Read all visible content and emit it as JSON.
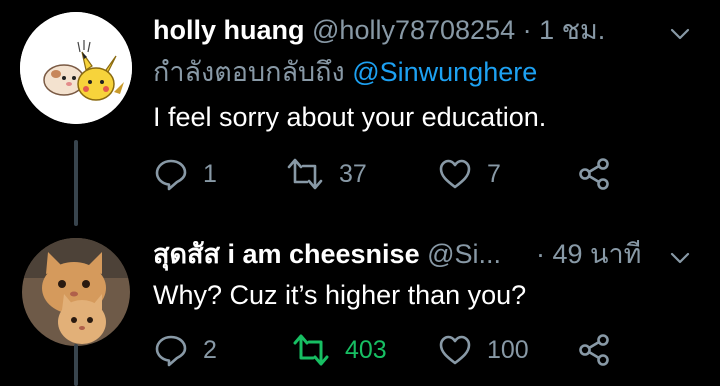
{
  "tweets": [
    {
      "display_name": "holly huang",
      "handle": "@holly78708254",
      "time": "· 1 ชม.",
      "reply_prefix": "กำลังตอบกลับถึง",
      "reply_to": "@Sinwunghere",
      "text": "I feel sorry about your education.",
      "replies": "1",
      "retweets": "37",
      "likes": "7",
      "retweeted": false
    },
    {
      "display_name": "สุดสัส i am cheesnise",
      "handle": "@Si...",
      "time": "· 49 นาที",
      "text": "Why? Cuz it’s higher than you?",
      "replies": "2",
      "retweets": "403",
      "likes": "100",
      "retweeted": true
    }
  ],
  "colors": {
    "background": "#000000",
    "text": "#ffffff",
    "muted": "#8899a6",
    "mention": "#1da1f2",
    "retweet_active": "#17bf63",
    "thread_line": "#38444d"
  },
  "icons": [
    "reply-icon",
    "retweet-icon",
    "like-icon",
    "share-icon",
    "chevron-down-icon"
  ]
}
